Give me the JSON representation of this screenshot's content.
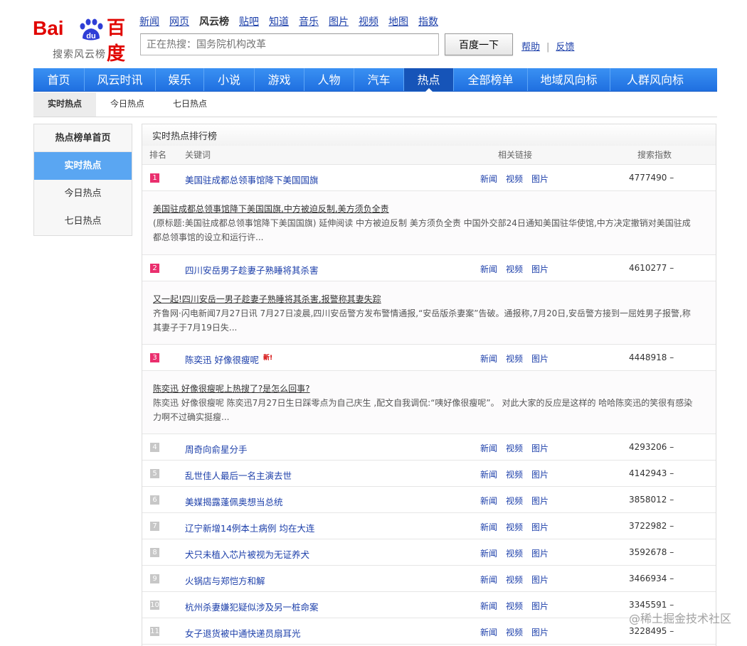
{
  "logo": {
    "bai": "Bai",
    "du": "du",
    "cn": "百度",
    "subtitle": "搜索风云榜"
  },
  "topnav": [
    "新闻",
    "网页",
    "风云榜",
    "贴吧",
    "知道",
    "音乐",
    "图片",
    "视频",
    "地图",
    "指数"
  ],
  "search": {
    "placeholder": "正在热搜：国务院机构改革",
    "button": "百度一下"
  },
  "help": {
    "help": "帮助",
    "sep": "|",
    "feedback": "反馈"
  },
  "mainnav": [
    "首页",
    "风云时讯",
    "娱乐",
    "小说",
    "游戏",
    "人物",
    "汽车",
    "热点",
    "全部榜单",
    "地域风向标",
    "人群风向标"
  ],
  "subtabs": [
    "实时热点",
    "今日热点",
    "七日热点"
  ],
  "side": {
    "title": "热点榜单首页",
    "items": [
      "实时热点",
      "今日热点",
      "七日热点"
    ]
  },
  "board": {
    "title": "实时热点排行榜",
    "cols": {
      "rank": "排名",
      "keyword": "关键词",
      "links": "相关链接",
      "index": "搜索指数"
    },
    "link_labels": [
      "新闻",
      "视频",
      "图片"
    ],
    "rows": [
      {
        "rank": "1",
        "keyword": "美国驻成都总领事馆降下美国国旗",
        "index": "4777490 –",
        "detail_title": "美国驻成都总领事馆降下美国国旗,中方被迫反制,美方须负全责",
        "detail_text": "(原标题:美国驻成都总领事馆降下美国国旗) 延伸阅读 中方被迫反制 美方须负全责 中国外交部24日通知美国驻华使馆,中方决定撤销对美国驻成都总领事馆的设立和运行许..."
      },
      {
        "rank": "2",
        "keyword": "四川安岳男子趁妻子熟睡将其杀害",
        "index": "4610277 –",
        "detail_title": "又一起!四川安岳一男子趁妻子熟睡将其杀害,报警称其妻失踪",
        "detail_text": "齐鲁网·闪电新闻7月27日讯 7月27日凌晨,四川安岳警方发布警情通报,“安岳版杀妻案”告破。通报称,7月20日,安岳警方接到一屈姓男子报警,称其妻子于7月19日失..."
      },
      {
        "rank": "3",
        "keyword": "陈奕迅 好像很瘦呢",
        "new": "新!",
        "index": "4448918 –",
        "detail_title": "陈奕迅 好像很瘦呢上热搜了?是怎么回事?",
        "detail_text": "陈奕迅 好像很瘦呢 陈奕迅7月27日生日踩零点为自己庆生 ,配文自我调侃:“咦好像很瘦呢”。 对此大家的反应是这样的 哈哈陈奕迅的笑很有感染力啊不过确实挺瘦..."
      },
      {
        "rank": "4",
        "keyword": "周奇向俞星分手",
        "index": "4293206 –"
      },
      {
        "rank": "5",
        "keyword": "乱世佳人最后一名主演去世",
        "index": "4142943 –"
      },
      {
        "rank": "6",
        "keyword": "美媒揭露蓬佩奥想当总统",
        "index": "3858012 –"
      },
      {
        "rank": "7",
        "keyword": "辽宁新增14例本土病例 均在大连",
        "index": "3722982 –"
      },
      {
        "rank": "8",
        "keyword": "犬只未植入芯片被视为无证养犬",
        "index": "3592678 –"
      },
      {
        "rank": "9",
        "keyword": "火锅店与郑恺方和解",
        "index": "3466934 –"
      },
      {
        "rank": "10",
        "keyword": "杭州杀妻嫌犯疑似涉及另一桩命案",
        "index": "3345591 –"
      },
      {
        "rank": "11",
        "keyword": "女子退货被中通快递员扇耳光",
        "index": "3228495 –"
      }
    ]
  },
  "watermark": "@稀土掘金技术社区"
}
